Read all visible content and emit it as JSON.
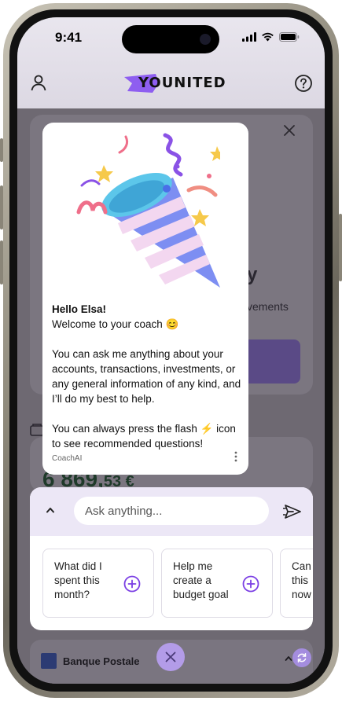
{
  "status_bar": {
    "time": "9:41"
  },
  "header": {
    "logo_text": "YOUNITED"
  },
  "background": {
    "partial_title": "y",
    "partial_subtitle": "vements",
    "balance_main": "6 869,",
    "balance_cents": "53 €"
  },
  "welcome_card": {
    "greeting": "Hello Elsa!",
    "welcome_line": "Welcome to your coach 😊",
    "paragraph_1": "You can ask me anything about your accounts, transactions, investments, or any general information of any kind, and I’ll do my best to help.",
    "paragraph_2": "You can always press the flash ⚡ icon to see recommended questions!",
    "footer_label": "CoachAI"
  },
  "assistant": {
    "input_placeholder": "Ask anything...",
    "suggestions": [
      {
        "label": "What did I spent this month?"
      },
      {
        "label": "Help me create a budget goal"
      },
      {
        "label": "Can this now"
      }
    ]
  },
  "bank_bar": {
    "bank_name": "Banque Postale"
  },
  "colors": {
    "accent_purple": "#7b3fe4",
    "fab_purple": "#b39ce8",
    "assist_top": "#ece7f6"
  }
}
